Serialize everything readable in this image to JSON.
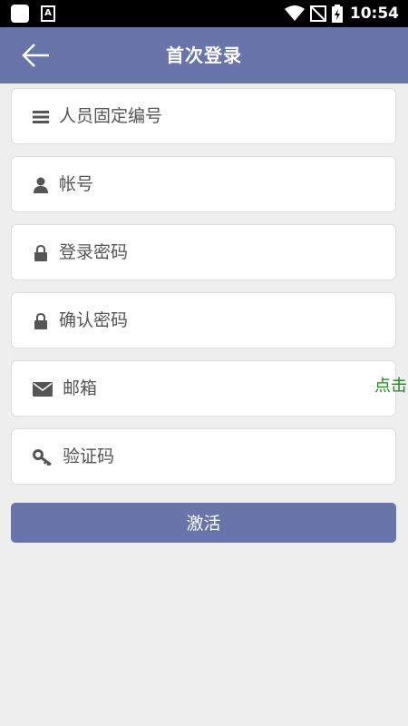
{
  "status_bar": {
    "time": "10:54",
    "left_app_icon": "a-letter-icon",
    "a_letter": "A"
  },
  "header": {
    "title": "首次登录",
    "back_icon": "back-arrow-icon"
  },
  "fields": [
    {
      "icon": "list-icon",
      "placeholder": "人员固定编号"
    },
    {
      "icon": "user-icon",
      "placeholder": "帐号"
    },
    {
      "icon": "lock-icon",
      "placeholder": "登录密码"
    },
    {
      "icon": "lock-icon",
      "placeholder": "确认密码"
    },
    {
      "icon": "envelope-icon",
      "placeholder": "邮箱"
    },
    {
      "icon": "key-icon",
      "placeholder": "验证码"
    }
  ],
  "send_code_link": "点击",
  "activate_button": "激活",
  "colors": {
    "accent": "#6874aa",
    "link": "#1f8a1f",
    "background": "#eeeeee"
  }
}
